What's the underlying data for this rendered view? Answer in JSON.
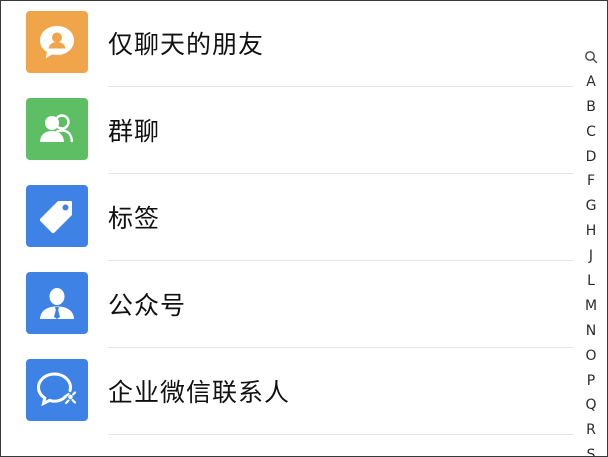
{
  "contacts_menu": {
    "items": [
      {
        "label": "仅聊天的朋友",
        "icon": "chat-bubble-person-icon",
        "color": "#F0A54A"
      },
      {
        "label": "群聊",
        "icon": "group-chat-icon",
        "color": "#5DBE63"
      },
      {
        "label": "标签",
        "icon": "tag-icon",
        "color": "#3F82E5"
      },
      {
        "label": "公众号",
        "icon": "official-account-person-icon",
        "color": "#3F82E5"
      },
      {
        "label": "企业微信联系人",
        "icon": "work-chat-icon",
        "color": "#3F82E5"
      }
    ]
  },
  "alphabet_index": {
    "search_icon": "search-icon",
    "letters": [
      "A",
      "B",
      "C",
      "D",
      "F",
      "G",
      "H",
      "J",
      "L",
      "M",
      "N",
      "O",
      "P",
      "Q",
      "R",
      "S"
    ]
  }
}
